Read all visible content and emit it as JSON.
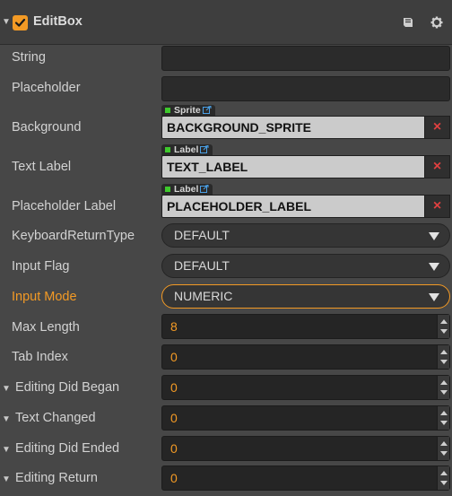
{
  "component": {
    "title": "EditBox",
    "enabled": true,
    "icons": [
      "book-icon",
      "gear-icon"
    ]
  },
  "colors": {
    "accent": "#f39a25",
    "panel_bg": "#474747",
    "clear_red": "#e04040",
    "tag_green": "#3ec92c"
  },
  "props": {
    "string": {
      "label": "String",
      "value": ""
    },
    "placeholder": {
      "label": "Placeholder",
      "value": ""
    },
    "background": {
      "label": "Background",
      "type_tag": "Sprite",
      "value": "BACKGROUND_SPRITE",
      "clear": "×"
    },
    "text_label": {
      "label": "Text Label",
      "type_tag": "Label",
      "value": "TEXT_LABEL",
      "clear": "×"
    },
    "placeholder_label": {
      "label": "Placeholder Label",
      "type_tag": "Label",
      "value": "PLACEHOLDER_LABEL",
      "clear": "×"
    },
    "keyboard_return_type": {
      "label": "KeyboardReturnType",
      "value": "DEFAULT"
    },
    "input_flag": {
      "label": "Input Flag",
      "value": "DEFAULT"
    },
    "input_mode": {
      "label": "Input Mode",
      "value": "NUMERIC"
    },
    "max_length": {
      "label": "Max Length",
      "value": "8"
    },
    "tab_index": {
      "label": "Tab Index",
      "value": "0"
    },
    "editing_did_began": {
      "label": "Editing Did Began",
      "value": "0"
    },
    "text_changed": {
      "label": "Text Changed",
      "value": "0"
    },
    "editing_did_ended": {
      "label": "Editing Did Ended",
      "value": "0"
    },
    "editing_return": {
      "label": "Editing Return",
      "value": "0"
    }
  }
}
